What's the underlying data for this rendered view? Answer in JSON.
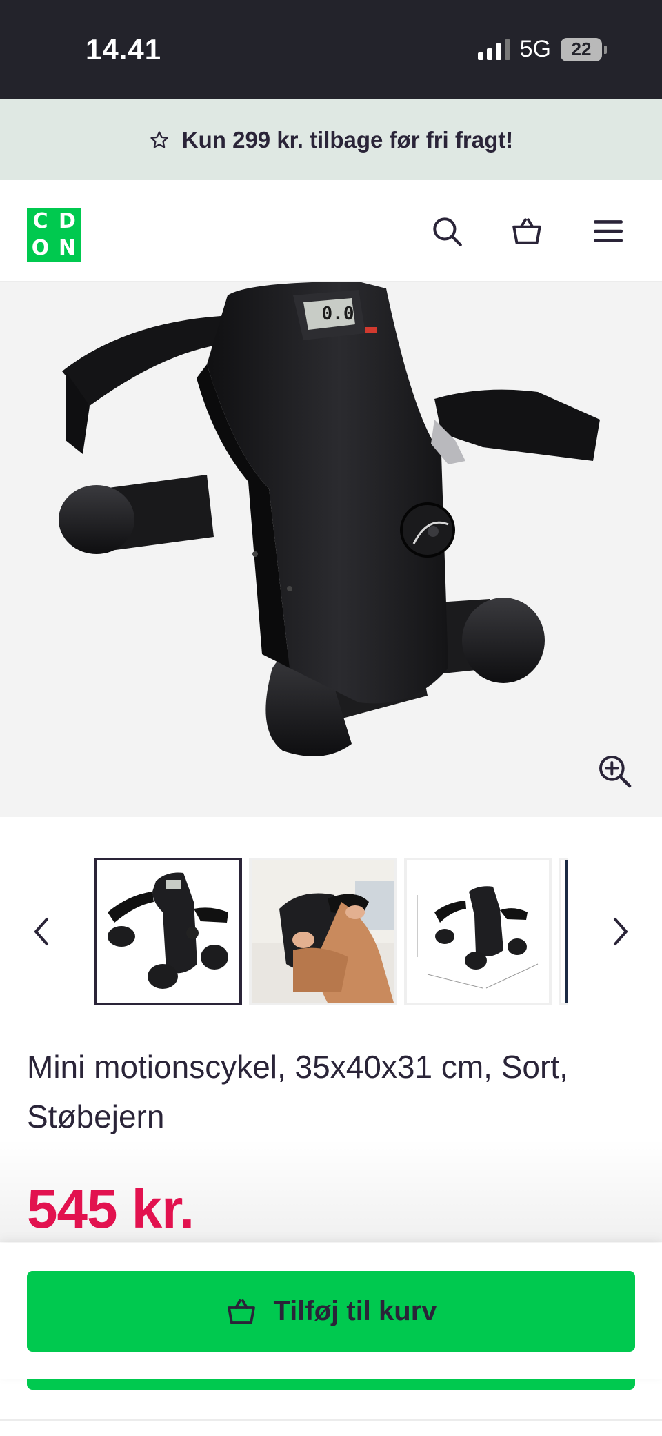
{
  "status_bar": {
    "time": "14.41",
    "network": "5G",
    "battery": "22",
    "signal_bars": 3
  },
  "promo": {
    "text": "Kun 299 kr. tilbage før fri fragt!",
    "icon": "star-outline-icon"
  },
  "header": {
    "logo_letters": [
      "C",
      "D",
      "O",
      "N"
    ],
    "logo_color": "#00c94f",
    "icons": [
      "search-icon",
      "basket-icon",
      "menu-icon"
    ]
  },
  "product": {
    "title": "Mini motionscykel, 35x40x31 cm, Sort, Støbejern",
    "price": "545 kr.",
    "price_color": "#e2124f",
    "display_reading": "0.0",
    "thumbnails": [
      "product-front",
      "product-in-use",
      "product-dimensions",
      "product-partial"
    ],
    "active_thumbnail": 0
  },
  "cta": {
    "add_to_cart": "Tilføj til kurv",
    "color": "#00c94f"
  }
}
